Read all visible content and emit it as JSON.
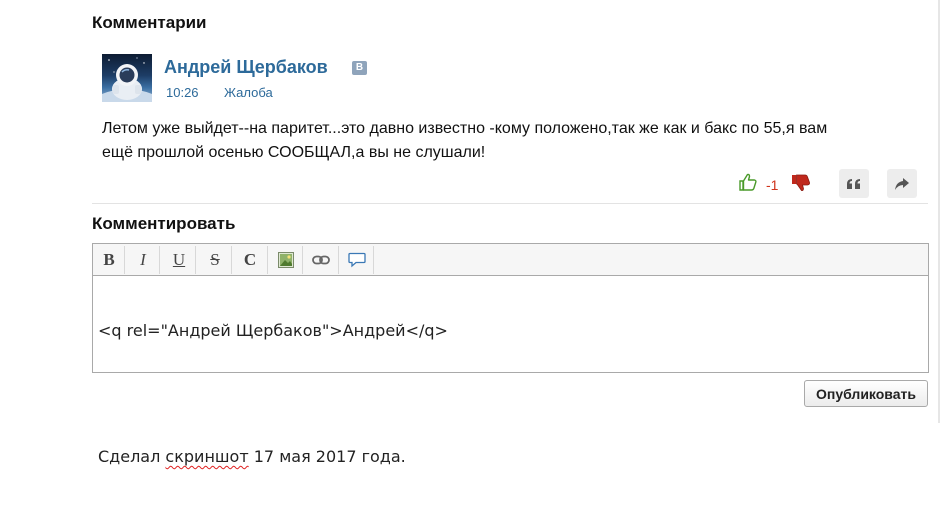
{
  "comments": {
    "title": "Комментарии",
    "items": [
      {
        "author": "Андрей Щербаков",
        "social_badge": "B",
        "time": "10:26",
        "complaint_label": "Жалоба",
        "text_line1": "Летом уже выйдет--на паритет...это давно известно -кому положено,так же как и бакс по 55,я вам",
        "text_line2": "ещё прошлой осенью СООБЩАЛ,а вы не слушали!",
        "rating": "-1",
        "icons": {
          "like": "thumbs-up-icon",
          "dislike": "thumbs-down-icon",
          "quote": "quote-icon",
          "share": "share-arrow-icon"
        }
      }
    ]
  },
  "reply": {
    "title": "Комментировать",
    "toolbar": [
      {
        "label": "B",
        "name": "bold-button"
      },
      {
        "label": "I",
        "name": "italic-button"
      },
      {
        "label": "U",
        "name": "underline-button"
      },
      {
        "label": "S",
        "name": "strikethrough-button"
      },
      {
        "label": "C",
        "name": "c-button"
      },
      {
        "label": "",
        "name": "insert-image-button",
        "icon": "image-icon"
      },
      {
        "label": "",
        "name": "insert-link-button",
        "icon": "link-icon"
      },
      {
        "label": "",
        "name": "insert-quote-button",
        "icon": "speech-bubble-icon"
      }
    ],
    "editor_line1": "<q rel=\"Андрей Щербаков\">Андрей</q>",
    "editor_line2_before": "Сделал ",
    "editor_line2_misspelled": "скриншот",
    "editor_line2_after": " 17 мая 2017 года.",
    "publish_label": "Опубликовать"
  },
  "colors": {
    "link": "#2d6a9a",
    "negative_rating": "#d0341c",
    "like_green": "#4a9a2a",
    "dislike_red": "#c0281c"
  }
}
